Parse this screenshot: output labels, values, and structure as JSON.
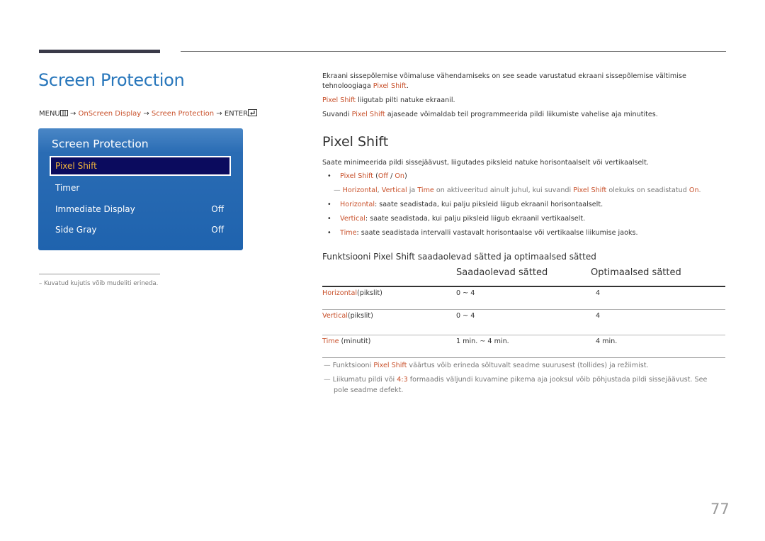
{
  "header": {
    "title": "Screen Protection"
  },
  "breadcrumb": {
    "menu": "MENU",
    "arrow": "→",
    "step1": "OnScreen Display",
    "step2": "Screen Protection",
    "enter": "ENTER"
  },
  "osd_menu": {
    "title": "Screen Protection",
    "items": [
      {
        "label": "Pixel Shift",
        "value": "",
        "selected": true
      },
      {
        "label": "Timer",
        "value": ""
      },
      {
        "label": "Immediate Display",
        "value": "Off"
      },
      {
        "label": "Side Gray",
        "value": "Off"
      }
    ]
  },
  "image_note": "–  Kuvatud kujutis võib mudeliti erineda.",
  "intro": {
    "p1a": "Ekraani sissepõlemise võimaluse vähendamiseks on see seade varustatud ekraani sissepõlemise vältimise",
    "p1b": "tehnoloogiaga ",
    "p1hl": "Pixel Shift",
    "p1end": ".",
    "p2hl": "Pixel Shift",
    "p2": " liigutab pilti natuke ekraanil.",
    "p3a": "Suvandi ",
    "p3hl": "Pixel Shift",
    "p3b": " ajaseade võimaldab teil programmeerida pildi liikumiste vahelise aja minutites."
  },
  "section": {
    "title": "Pixel Shift",
    "desc": "Saate minimeerida pildi sissejäävust, liigutades piksleid natuke horisontaalselt või vertikaalselt.",
    "option": {
      "name": "Pixel Shift",
      "open": " (",
      "off": "Off",
      "sep": " / ",
      "on": "On",
      "close": ")"
    },
    "note": {
      "dash": "—",
      "h": "Horizontal",
      "c1": ", ",
      "v": "Vertical",
      "c2": " ja ",
      "t": "Time",
      "mid": " on aktiveeritud ainult juhul, kui suvandi ",
      "ps": "Pixel Shift",
      "mid2": " olekuks on seadistatud ",
      "on": "On",
      "end": "."
    },
    "bullets": [
      {
        "term": "Horizontal",
        "text": ": saate seadistada, kui palju piksleid liigub ekraanil horisontaalselt."
      },
      {
        "term": "Vertical",
        "text": ": saate seadistada, kui palju piksleid liigub ekraanil vertikaalselt."
      },
      {
        "term": "Time",
        "text": ": saate seadistada intervalli vastavalt horisontaalse või vertikaalse liikumise jaoks."
      }
    ]
  },
  "table": {
    "title": "Funktsiooni Pixel Shift saadaolevad sätted ja optimaalsed sätted",
    "headers": [
      "",
      "Saadaolevad sätted",
      "Optimaalsed sätted"
    ],
    "rows": [
      {
        "term": "Horizontal",
        "unit": "(pikslit)",
        "available": "0 ~ 4",
        "optimal": "4"
      },
      {
        "term": "Vertical",
        "unit": "(pikslit)",
        "available": "0 ~ 4",
        "optimal": "4"
      },
      {
        "term": "Time",
        "unit": " (minutit)",
        "available": "1 min. ~ 4 min.",
        "optimal": "4 min."
      }
    ]
  },
  "footnotes": {
    "n1": {
      "dash": "—",
      "a": " Funktsiooni ",
      "hl": "Pixel Shift",
      "b": " väärtus võib erineda sõltuvalt seadme suurusest (tollides) ja režiimist."
    },
    "n2": {
      "dash": "—",
      "a": " Liikumatu pildi või ",
      "hl": "4:3",
      "b": " formaadis väljundi kuvamine pikema aja jooksul võib põhjustada pildi sissejäävust. See",
      "c": "pole seadme defekt."
    }
  },
  "page_number": "77",
  "colors": {
    "accent": "#c8502a",
    "title_blue": "#2776bb",
    "osd_blue": "#1f63ae",
    "osd_selected": "#0b0b5e",
    "osd_selected_text": "#f0b43c"
  }
}
